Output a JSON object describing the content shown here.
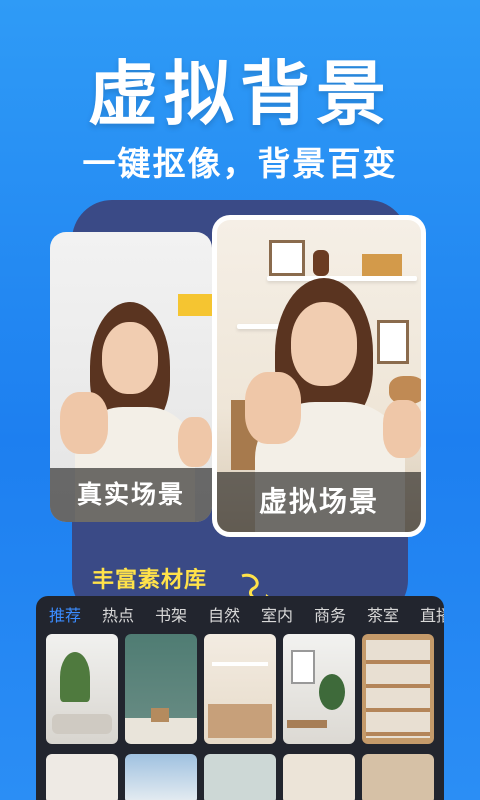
{
  "header": {
    "title": "虚拟背景",
    "subtitle": "一键抠像，背景百变"
  },
  "comparison": {
    "real_label": "真实场景",
    "virtual_label": "虚拟场景"
  },
  "library": {
    "title": "丰富素材库",
    "tabs": [
      {
        "label": "推荐",
        "active": true
      },
      {
        "label": "热点",
        "active": false
      },
      {
        "label": "书架",
        "active": false
      },
      {
        "label": "自然",
        "active": false
      },
      {
        "label": "室内",
        "active": false
      },
      {
        "label": "商务",
        "active": false
      },
      {
        "label": "茶室",
        "active": false
      },
      {
        "label": "直播",
        "active": false
      }
    ]
  },
  "colors": {
    "background": "#1d7ff0",
    "accent_yellow": "#ffe24a",
    "tab_active": "#3b8cff",
    "panel": "#22252e"
  }
}
